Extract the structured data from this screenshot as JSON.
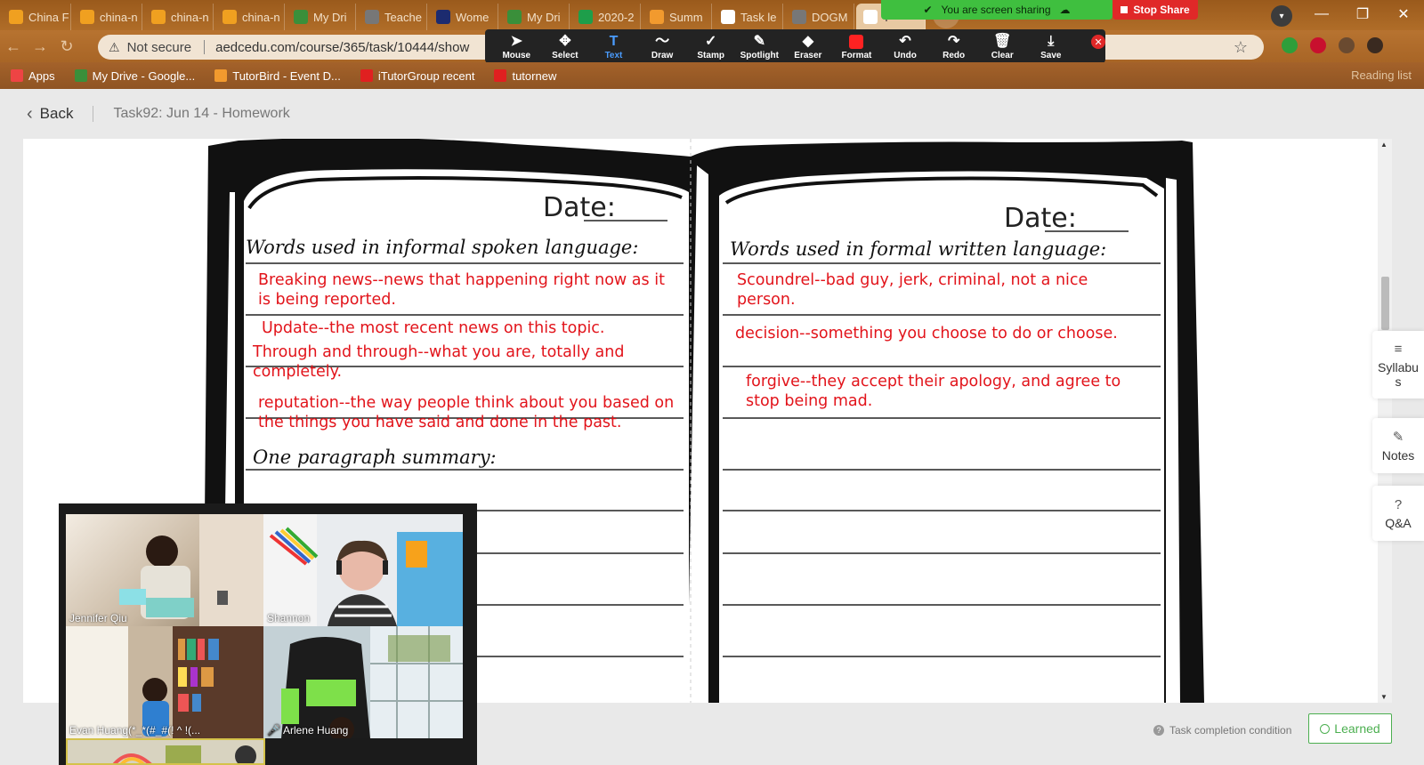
{
  "browser": {
    "tabs": [
      {
        "label": "China F",
        "icon": "iTutor-icon",
        "color": "#f0a020"
      },
      {
        "label": "china-n",
        "icon": "iTutor-icon",
        "color": "#f0a020"
      },
      {
        "label": "china-n",
        "icon": "iTutor-icon",
        "color": "#f0a020"
      },
      {
        "label": "china-n",
        "icon": "iTutor-icon",
        "color": "#f0a020"
      },
      {
        "label": "My Dri",
        "icon": "google-drive-icon",
        "color": "#3a8f3a"
      },
      {
        "label": "Teache",
        "icon": "globe-icon",
        "color": "#777777"
      },
      {
        "label": "Wome",
        "icon": "publication-icon",
        "color": "#1c2b6f"
      },
      {
        "label": "My Dri",
        "icon": "google-drive-icon",
        "color": "#3a8f3a"
      },
      {
        "label": "2020-2",
        "icon": "google-sheets-icon",
        "color": "#1e9e4a"
      },
      {
        "label": "Summ",
        "icon": "tutorbird-icon",
        "color": "#f29a2e"
      },
      {
        "label": "Task le",
        "icon": "task-icon",
        "color": "#ffffff"
      },
      {
        "label": "DOGM",
        "icon": "globe-icon",
        "color": "#777777"
      },
      {
        "label": "T",
        "icon": "task-icon",
        "color": "#ffffff"
      }
    ],
    "new_tab": "+",
    "url": "aedcedu.com/course/365/task/10444/show",
    "security_label": "Not secure",
    "bookmarks": [
      {
        "label": "Apps",
        "color": "#e44"
      },
      {
        "label": "My Drive - Google...",
        "color": "#3a8f3a"
      },
      {
        "label": "TutorBird - Event D...",
        "color": "#f29a2e"
      },
      {
        "label": "iTutorGroup recent",
        "color": "#e02020"
      },
      {
        "label": "tutornew",
        "color": "#e02020"
      }
    ],
    "reading_list": "Reading list"
  },
  "zoom": {
    "sharing_banner": "You are screen sharing",
    "stop_share": "Stop Share",
    "tools": [
      {
        "label": "Mouse",
        "icon": "cursor-icon",
        "glyph": "➤"
      },
      {
        "label": "Select",
        "icon": "move-icon",
        "glyph": "✥"
      },
      {
        "label": "Text",
        "icon": "text-icon",
        "glyph": "T"
      },
      {
        "label": "Draw",
        "icon": "draw-icon",
        "glyph": "〜"
      },
      {
        "label": "Stamp",
        "icon": "stamp-icon",
        "glyph": "✓"
      },
      {
        "label": "Spotlight",
        "icon": "spotlight-icon",
        "glyph": "✎"
      },
      {
        "label": "Eraser",
        "icon": "eraser-icon",
        "glyph": "◆"
      },
      {
        "label": "Format",
        "icon": "format-icon",
        "glyph": ""
      },
      {
        "label": "Undo",
        "icon": "undo-icon",
        "glyph": "↶"
      },
      {
        "label": "Redo",
        "icon": "redo-icon",
        "glyph": "↷"
      },
      {
        "label": "Clear",
        "icon": "trash-icon",
        "glyph": "🗑"
      },
      {
        "label": "Save",
        "icon": "save-icon",
        "glyph": "⤓"
      }
    ],
    "active_tool": "Text",
    "participants": [
      {
        "name": "Jennifer Qiu",
        "muted": false
      },
      {
        "name": "Shannon",
        "muted": false
      },
      {
        "name": "Evan Huang(*_*(#_#(! ^ !(...",
        "muted": false
      },
      {
        "name": "Arlene Huang",
        "muted": true
      }
    ]
  },
  "page": {
    "back_label": "Back",
    "task_title": "Task92:  Jun 14 - Homework",
    "side_buttons": [
      {
        "label": "Syllabus",
        "icon": "menu-icon",
        "glyph": "≡"
      },
      {
        "label": "Notes",
        "icon": "pencil-icon",
        "glyph": "✎"
      },
      {
        "label": "Q&A",
        "icon": "question-icon",
        "glyph": "?"
      }
    ],
    "completion_label": "Task completion condition",
    "learned_label": "Learned"
  },
  "worksheet": {
    "left": {
      "date_label": "Date:",
      "heading": "Words used in informal spoken language:",
      "entries": [
        "Breaking news--news that happening right now as it is being reported.",
        "Update--the most recent news on this topic.",
        "Through and through--what you are, totally and completely.",
        "reputation--the way people think about you based on the things you have said and done in the past."
      ],
      "summary_heading": "One paragraph summary:"
    },
    "right": {
      "date_label": "Date:",
      "heading": "Words used in formal written language:",
      "entries": [
        "Scoundrel--bad guy, jerk, criminal, not a nice person.",
        "decision--something you choose to do or choose.",
        "forgive--they accept their apology, and agree to stop being mad."
      ]
    }
  }
}
